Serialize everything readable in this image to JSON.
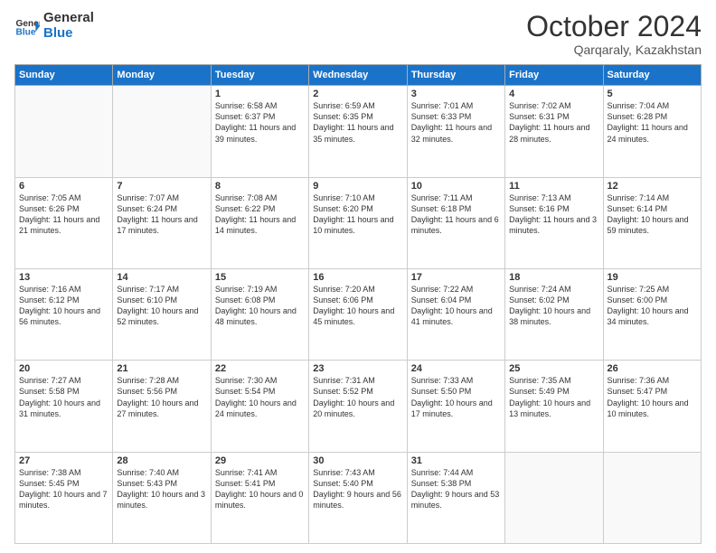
{
  "header": {
    "logo_general": "General",
    "logo_blue": "Blue",
    "month_title": "October 2024",
    "subtitle": "Qarqaraly, Kazakhstan"
  },
  "weekdays": [
    "Sunday",
    "Monday",
    "Tuesday",
    "Wednesday",
    "Thursday",
    "Friday",
    "Saturday"
  ],
  "rows": [
    [
      {
        "day": "",
        "info": ""
      },
      {
        "day": "",
        "info": ""
      },
      {
        "day": "1",
        "info": "Sunrise: 6:58 AM\nSunset: 6:37 PM\nDaylight: 11 hours and 39 minutes."
      },
      {
        "day": "2",
        "info": "Sunrise: 6:59 AM\nSunset: 6:35 PM\nDaylight: 11 hours and 35 minutes."
      },
      {
        "day": "3",
        "info": "Sunrise: 7:01 AM\nSunset: 6:33 PM\nDaylight: 11 hours and 32 minutes."
      },
      {
        "day": "4",
        "info": "Sunrise: 7:02 AM\nSunset: 6:31 PM\nDaylight: 11 hours and 28 minutes."
      },
      {
        "day": "5",
        "info": "Sunrise: 7:04 AM\nSunset: 6:28 PM\nDaylight: 11 hours and 24 minutes."
      }
    ],
    [
      {
        "day": "6",
        "info": "Sunrise: 7:05 AM\nSunset: 6:26 PM\nDaylight: 11 hours and 21 minutes."
      },
      {
        "day": "7",
        "info": "Sunrise: 7:07 AM\nSunset: 6:24 PM\nDaylight: 11 hours and 17 minutes."
      },
      {
        "day": "8",
        "info": "Sunrise: 7:08 AM\nSunset: 6:22 PM\nDaylight: 11 hours and 14 minutes."
      },
      {
        "day": "9",
        "info": "Sunrise: 7:10 AM\nSunset: 6:20 PM\nDaylight: 11 hours and 10 minutes."
      },
      {
        "day": "10",
        "info": "Sunrise: 7:11 AM\nSunset: 6:18 PM\nDaylight: 11 hours and 6 minutes."
      },
      {
        "day": "11",
        "info": "Sunrise: 7:13 AM\nSunset: 6:16 PM\nDaylight: 11 hours and 3 minutes."
      },
      {
        "day": "12",
        "info": "Sunrise: 7:14 AM\nSunset: 6:14 PM\nDaylight: 10 hours and 59 minutes."
      }
    ],
    [
      {
        "day": "13",
        "info": "Sunrise: 7:16 AM\nSunset: 6:12 PM\nDaylight: 10 hours and 56 minutes."
      },
      {
        "day": "14",
        "info": "Sunrise: 7:17 AM\nSunset: 6:10 PM\nDaylight: 10 hours and 52 minutes."
      },
      {
        "day": "15",
        "info": "Sunrise: 7:19 AM\nSunset: 6:08 PM\nDaylight: 10 hours and 48 minutes."
      },
      {
        "day": "16",
        "info": "Sunrise: 7:20 AM\nSunset: 6:06 PM\nDaylight: 10 hours and 45 minutes."
      },
      {
        "day": "17",
        "info": "Sunrise: 7:22 AM\nSunset: 6:04 PM\nDaylight: 10 hours and 41 minutes."
      },
      {
        "day": "18",
        "info": "Sunrise: 7:24 AM\nSunset: 6:02 PM\nDaylight: 10 hours and 38 minutes."
      },
      {
        "day": "19",
        "info": "Sunrise: 7:25 AM\nSunset: 6:00 PM\nDaylight: 10 hours and 34 minutes."
      }
    ],
    [
      {
        "day": "20",
        "info": "Sunrise: 7:27 AM\nSunset: 5:58 PM\nDaylight: 10 hours and 31 minutes."
      },
      {
        "day": "21",
        "info": "Sunrise: 7:28 AM\nSunset: 5:56 PM\nDaylight: 10 hours and 27 minutes."
      },
      {
        "day": "22",
        "info": "Sunrise: 7:30 AM\nSunset: 5:54 PM\nDaylight: 10 hours and 24 minutes."
      },
      {
        "day": "23",
        "info": "Sunrise: 7:31 AM\nSunset: 5:52 PM\nDaylight: 10 hours and 20 minutes."
      },
      {
        "day": "24",
        "info": "Sunrise: 7:33 AM\nSunset: 5:50 PM\nDaylight: 10 hours and 17 minutes."
      },
      {
        "day": "25",
        "info": "Sunrise: 7:35 AM\nSunset: 5:49 PM\nDaylight: 10 hours and 13 minutes."
      },
      {
        "day": "26",
        "info": "Sunrise: 7:36 AM\nSunset: 5:47 PM\nDaylight: 10 hours and 10 minutes."
      }
    ],
    [
      {
        "day": "27",
        "info": "Sunrise: 7:38 AM\nSunset: 5:45 PM\nDaylight: 10 hours and 7 minutes."
      },
      {
        "day": "28",
        "info": "Sunrise: 7:40 AM\nSunset: 5:43 PM\nDaylight: 10 hours and 3 minutes."
      },
      {
        "day": "29",
        "info": "Sunrise: 7:41 AM\nSunset: 5:41 PM\nDaylight: 10 hours and 0 minutes."
      },
      {
        "day": "30",
        "info": "Sunrise: 7:43 AM\nSunset: 5:40 PM\nDaylight: 9 hours and 56 minutes."
      },
      {
        "day": "31",
        "info": "Sunrise: 7:44 AM\nSunset: 5:38 PM\nDaylight: 9 hours and 53 minutes."
      },
      {
        "day": "",
        "info": ""
      },
      {
        "day": "",
        "info": ""
      }
    ]
  ]
}
